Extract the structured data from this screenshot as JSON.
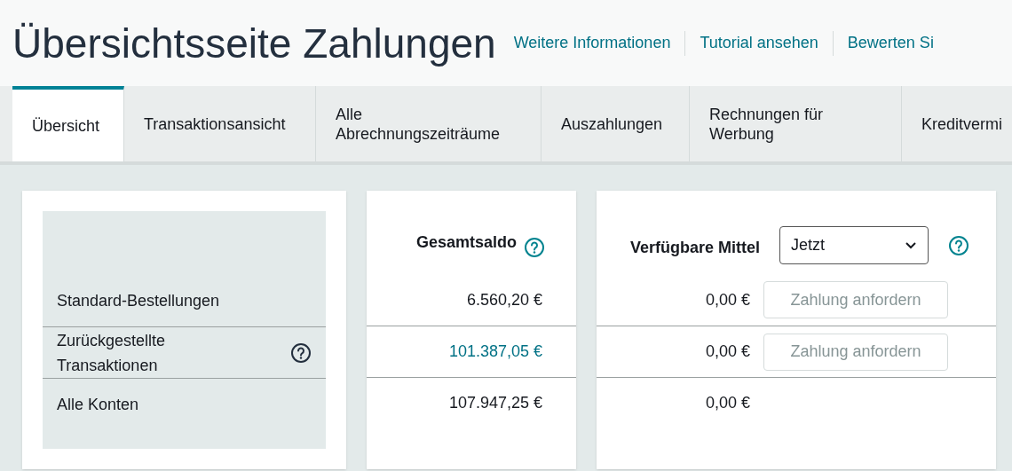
{
  "header": {
    "title": "Übersichtsseite Zahlungen",
    "links": [
      "Weitere Informationen",
      "Tutorial ansehen",
      "Bewerten Si"
    ]
  },
  "tabs": [
    {
      "label": "Übersicht",
      "selected": true
    },
    {
      "label": "Transaktionsansicht",
      "selected": false
    },
    {
      "label": "Alle Abrechnungszeiträume",
      "selected": false
    },
    {
      "label": "Auszahlungen",
      "selected": false
    },
    {
      "label": "Rechnungen für Werbung",
      "selected": false
    },
    {
      "label": "Kreditvermi",
      "selected": false
    }
  ],
  "summary": {
    "rows": [
      {
        "label": "Standard-Bestellungen",
        "help": false,
        "total": "6.560,20 €",
        "total_link": false,
        "available": "0,00 €",
        "button": {
          "label": "Zahlung anfordern",
          "disabled": true
        }
      },
      {
        "label": "Zurückgestellte Transaktionen",
        "help": true,
        "total": "101.387,05 €",
        "total_link": true,
        "available": "0,00 €",
        "button": {
          "label": "Zahlung anfordern",
          "disabled": true
        }
      },
      {
        "label": "Alle Konten",
        "help": false,
        "total": "107.947,25 €",
        "total_link": false,
        "available": "0,00 €"
      }
    ],
    "total_heading": "Gesamtsaldo",
    "available_heading": "Verfügbare Mittel",
    "period_select": {
      "value": "Jetzt"
    }
  }
}
